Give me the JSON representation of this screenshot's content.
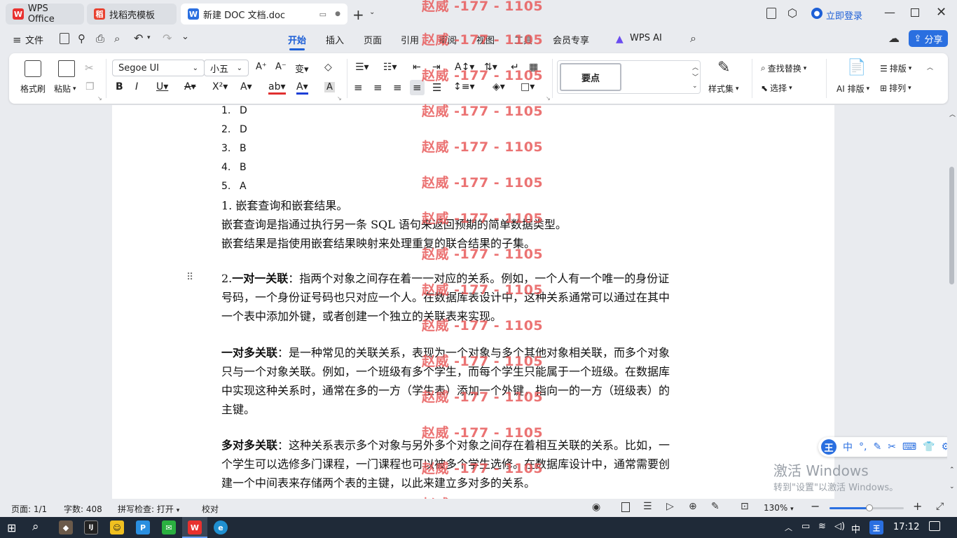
{
  "tabs": [
    {
      "label": "WPS Office"
    },
    {
      "label": "找稻壳模板"
    },
    {
      "label": "新建 DOC 文档.doc"
    }
  ],
  "titlebar": {
    "login": "立即登录"
  },
  "menu": {
    "file": "文件",
    "items": [
      "开始",
      "插入",
      "页面",
      "引用",
      "审阅",
      "视图",
      "工具",
      "会员专享",
      "WPS AI"
    ],
    "share": "分享"
  },
  "ribbon": {
    "format_painter": "格式刷",
    "paste": "粘贴",
    "font_name": "Segoe UI",
    "font_size": "小五",
    "style_preview": "要点",
    "style_set": "样式集",
    "find_replace": "查找替换",
    "select": "选择",
    "ai_layout": "AI 排版",
    "layout": "排版",
    "arrange": "排列"
  },
  "document": {
    "answers": [
      {
        "n": "1.",
        "v": "D"
      },
      {
        "n": "2.",
        "v": "D"
      },
      {
        "n": "3.",
        "v": "B"
      },
      {
        "n": "4.",
        "v": "B"
      },
      {
        "n": "5.",
        "v": "A"
      }
    ],
    "q1_title": "1.  嵌套查询和嵌套结果。",
    "q1_line1": "嵌套查询是指通过执行另一条 SQL 语句来返回预期的简单数据类型。",
    "q1_line2": "嵌套结果是指使用嵌套结果映射来处理重复的联合结果的子集。",
    "p1_bold": "一对一关联",
    "p1_prefix": "2.",
    "p1_l1": "：指两个对象之间存在着一一对应的关系。例如，一个人有一个唯一的身份证",
    "p1_l2": "号码，一个身份证号码也只对应一个人。在数据库表设计中，这种关系通常可以通过在其中",
    "p1_l3": "一个表中添加外键，或者创建一个独立的关联表来实现。",
    "p2_bold": "一对多关联",
    "p2_l1": "：是一种常见的关联关系，表现为一个对象与多个其他对象相关联，而多个对象",
    "p2_l2": "只与一个对象关联。例如，一个班级有多个学生，而每个学生只能属于一个班级。在数据库",
    "p2_l3": "中实现这种关系时，通常在多的一方（学生表）添加一个外键，指向一的一方（班级表）的",
    "p2_l4": "主键。",
    "p3_bold": "多对多关联",
    "p3_l1": "：这种关系表示多个对象与另外多个对象之间存在着相互关联的关系。比如，一",
    "p3_l2": "个学生可以选修多门课程，一门课程也可以被多个学生选修。在数据库设计中，通常需要创",
    "p3_l3": "建一个中间表来存储两个表的主键，以此来建立多对多的关系。"
  },
  "watermark": "赵威 -177 - 1105",
  "activation": {
    "line1": "激活 Windows",
    "line2": "转到\"设置\"以激活 Windows。"
  },
  "ime": {
    "mode": "中"
  },
  "status": {
    "page": "页面: 1/1",
    "words": "字数: 408",
    "spell": "拼写检查: 打开",
    "proof": "校对",
    "zoom": "130%"
  },
  "taskbar": {
    "time": "17:12",
    "lang": "中"
  }
}
